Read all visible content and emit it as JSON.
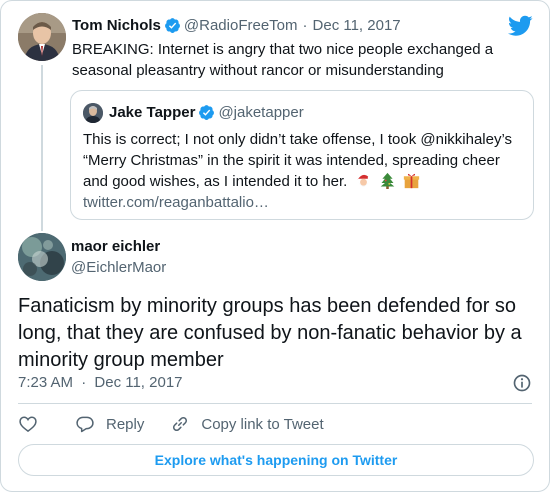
{
  "parent_tweet": {
    "author_name": "Tom Nichols",
    "author_handle": "@RadioFreeTom",
    "separator": "·",
    "date": "Dec 11, 2017",
    "text": "BREAKING: Internet is angry that two nice people exchanged a seasonal pleasantry without rancor or misunderstanding"
  },
  "quoted_tweet": {
    "author_name": "Jake Tapper",
    "author_handle": "@jaketapper",
    "text": "This is correct; I not only didn’t take offense, I took @nikkihaley’s “Merry Christmas” in the spirit it was intended, spreading cheer and good wishes, as I intended it to her.",
    "link": "twitter.com/reaganbattalio…"
  },
  "main_tweet": {
    "author_name": "maor eichler",
    "author_handle": "@EichlerMaor",
    "text": "Fanaticism by minority groups has been defended for so long, that they are confused by non-fanatic behavior  by a minority group member",
    "time": "7:23 AM",
    "separator": "·",
    "date": "Dec 11, 2017"
  },
  "actions": {
    "reply_label": "Reply",
    "copy_label": "Copy link to Tweet"
  },
  "explore_label": "Explore what's happening on Twitter",
  "colors": {
    "brand_blue": "#1d9bf0",
    "text_primary": "#0f1419",
    "text_secondary": "#536471",
    "border": "#cfd9de"
  },
  "icons": [
    "twitter-bird-icon",
    "verified-badge-icon",
    "santa-emoji-icon",
    "christmas-tree-emoji-icon",
    "gift-emoji-icon",
    "info-icon",
    "heart-icon",
    "reply-icon",
    "link-icon"
  ]
}
